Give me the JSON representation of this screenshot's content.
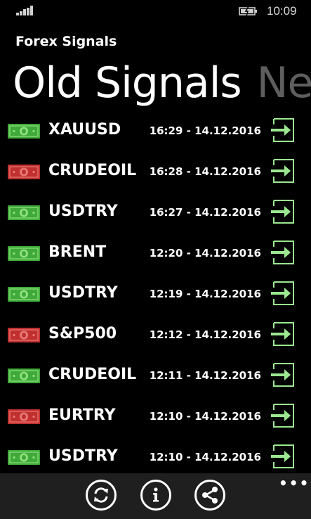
{
  "status_bar": {
    "time": "10:09"
  },
  "app": {
    "title": "Forex Signals"
  },
  "pivot": {
    "active_label": "Old Signals",
    "next_label": "Ne"
  },
  "colors": {
    "buy": "#3fa93a",
    "sell": "#c0302f",
    "arrow": "#9be890"
  },
  "signals": [
    {
      "symbol": "XAUUSD",
      "time": "16:29 - 14.12.2016",
      "direction": "buy"
    },
    {
      "symbol": "CRUDEOIL",
      "time": "16:28 - 14.12.2016",
      "direction": "sell"
    },
    {
      "symbol": "USDTRY",
      "time": "16:27 - 14.12.2016",
      "direction": "buy"
    },
    {
      "symbol": "BRENT",
      "time": "12:20 - 14.12.2016",
      "direction": "buy"
    },
    {
      "symbol": "USDTRY",
      "time": "12:19 - 14.12.2016",
      "direction": "buy"
    },
    {
      "symbol": "S&P500",
      "time": "12:12 - 14.12.2016",
      "direction": "sell"
    },
    {
      "symbol": "CRUDEOIL",
      "time": "12:11 - 14.12.2016",
      "direction": "buy"
    },
    {
      "symbol": "EURTRY",
      "time": "12:10 - 14.12.2016",
      "direction": "sell"
    },
    {
      "symbol": "USDTRY",
      "time": "12:10 - 14.12.2016",
      "direction": "buy"
    }
  ],
  "app_bar": {
    "buttons": [
      {
        "name": "refresh-button",
        "icon": "refresh-icon"
      },
      {
        "name": "info-button",
        "icon": "info-icon"
      },
      {
        "name": "share-button",
        "icon": "share-icon"
      }
    ],
    "more_label": "•••"
  }
}
